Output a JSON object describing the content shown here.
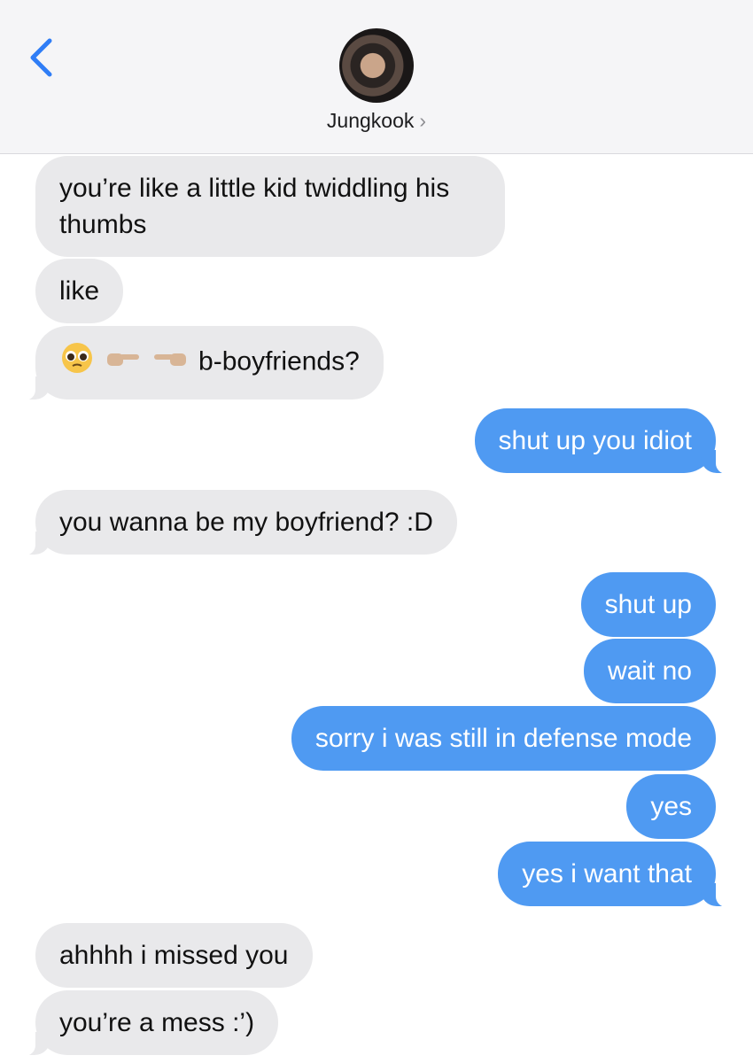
{
  "header": {
    "contact_name": "Jungkook",
    "chevron": "›"
  },
  "messages": [
    {
      "id": "m1",
      "side": "received",
      "text": "you’re like a little kid twiddling his thumbs"
    },
    {
      "id": "m2",
      "side": "received",
      "text": "like"
    },
    {
      "id": "m3",
      "side": "received",
      "text": "b-boyfriends?",
      "emoji": [
        "pleading-face",
        "finger-pointing-right",
        "finger-pointing-left"
      ]
    },
    {
      "id": "m4",
      "side": "sent",
      "text": "shut up you idiot"
    },
    {
      "id": "m5",
      "side": "received",
      "text": "you wanna be my boyfriend? :D"
    },
    {
      "id": "m6",
      "side": "sent",
      "text": "shut up"
    },
    {
      "id": "m7",
      "side": "sent",
      "text": "wait no"
    },
    {
      "id": "m8",
      "side": "sent",
      "text": "sorry i was still in defense mode"
    },
    {
      "id": "m9",
      "side": "sent",
      "text": "yes"
    },
    {
      "id": "m10",
      "side": "sent",
      "text": "yes i want that"
    },
    {
      "id": "m11",
      "side": "received",
      "text": "ahhhh i missed you"
    },
    {
      "id": "m12",
      "side": "received",
      "text": "you’re a mess :’)"
    }
  ],
  "colors": {
    "sent_bubble": "#4f9af2",
    "received_bubble": "#e9e9eb",
    "header_bg": "#f5f5f7",
    "accent": "#2f7df6"
  },
  "icons": {
    "back": "chevron-left-icon",
    "contact_chevron": "chevron-right-icon"
  }
}
